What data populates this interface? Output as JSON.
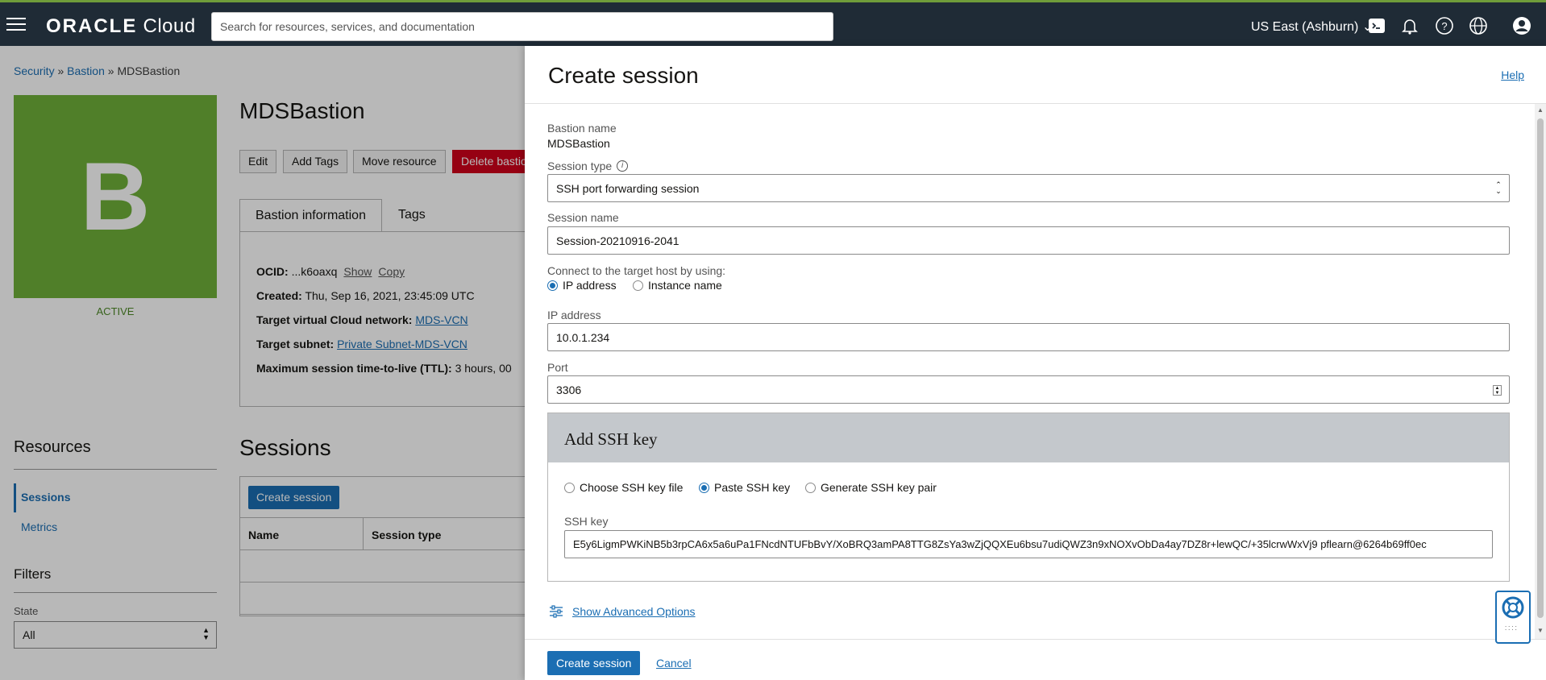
{
  "topbar": {
    "logo_brand": "ORACLE",
    "logo_product": "Cloud",
    "search_placeholder": "Search for resources, services, and documentation",
    "region": "US East (Ashburn)"
  },
  "background": {
    "breadcrumb": {
      "security": "Security",
      "sep1": "»",
      "bastion": "Bastion",
      "sep2": "»",
      "current": "MDSBastion"
    },
    "avatar_letter": "B",
    "status": "ACTIVE",
    "title": "MDSBastion",
    "buttons": {
      "edit": "Edit",
      "add_tags": "Add Tags",
      "move": "Move resource",
      "delete": "Delete bastion"
    },
    "tabs": {
      "info": "Bastion information",
      "tags": "Tags"
    },
    "info": {
      "ocid_label": "OCID:",
      "ocid_value": "...k6oaxq",
      "show": "Show",
      "copy": "Copy",
      "created_label": "Created:",
      "created_value": "Thu, Sep 16, 2021, 23:45:09 UTC",
      "vcn_label": "Target virtual Cloud network:",
      "vcn_value": "MDS-VCN",
      "subnet_label": "Target subnet:",
      "subnet_value": "Private Subnet-MDS-VCN",
      "ttl_label": "Maximum session time-to-live (TTL):",
      "ttl_value": "3 hours, 00"
    },
    "resources": {
      "title": "Resources",
      "sessions": "Sessions",
      "metrics": "Metrics"
    },
    "filters": {
      "title": "Filters",
      "state_label": "State",
      "state_value": "All"
    },
    "sessions": {
      "title": "Sessions",
      "create": "Create session",
      "col_name": "Name",
      "col_type": "Session type"
    }
  },
  "panel": {
    "title": "Create session",
    "help": "Help",
    "bastion_name_label": "Bastion name",
    "bastion_name_value": "MDSBastion",
    "session_type_label": "Session type",
    "session_type_value": "SSH port forwarding session",
    "session_name_label": "Session name",
    "session_name_value": "Session-20210916-2041",
    "connect_label": "Connect to the target host by using:",
    "connect_options": [
      "IP address",
      "Instance name"
    ],
    "connect_selected": "IP address",
    "ip_label": "IP address",
    "ip_value": "10.0.1.234",
    "port_label": "Port",
    "port_value": "3306",
    "ssh": {
      "title": "Add SSH key",
      "options": [
        "Choose SSH key file",
        "Paste SSH key",
        "Generate SSH key pair"
      ],
      "selected": "Paste SSH key",
      "key_label": "SSH key",
      "key_value": "E5y6LigmPWKiNB5b3rpCA6x5a6uPa1FNcdNTUFbBvY/XoBRQ3amPA8TTG8ZsYa3wZjQQXEu6bsu7udiQWZ3n9xNOXvObDa4ay7DZ8r+lewQC/+35lcrwWxVj9 pflearn@6264b69ff0ec"
    },
    "advanced": "Show Advanced Options",
    "create_button": "Create session",
    "cancel": "Cancel"
  },
  "colors": {
    "accent": "#1b6eb3",
    "topbar": "#1f2b36",
    "active_green": "#6fb03a",
    "delete_red": "#d0021b"
  }
}
